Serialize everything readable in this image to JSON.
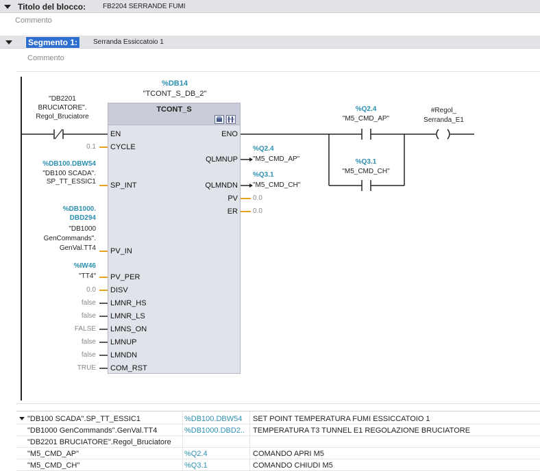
{
  "block": {
    "title_label": "Titolo del blocco:",
    "title_value": "FB2204 SERRANDE FUMI",
    "comment": "Commento"
  },
  "segment": {
    "label": "Segmento 1:",
    "title": "Serranda Essiccatoio 1",
    "comment": "Commento"
  },
  "instance": {
    "address": "%DB14",
    "name": "\"TCONT_S_DB_2\"",
    "type": "TCONT_S"
  },
  "contact": {
    "name_lines": [
      "\"DB2201",
      "BRUCIATORE\".",
      "Regol_Bruciatore"
    ]
  },
  "inputs": {
    "en": "EN",
    "cycle": {
      "pin": "CYCLE",
      "value": "0.1"
    },
    "sp_int": {
      "pin": "SP_INT",
      "address": "%DB100.DBW54",
      "name_lines": [
        "\"DB100 SCADA\".",
        "SP_TT_ESSIC1"
      ]
    },
    "pv_in": {
      "pin": "PV_IN",
      "address_lines": [
        "%DB1000.",
        "DBD294"
      ],
      "name_lines": [
        "\"DB1000",
        "GenCommands\".",
        "GenVal.TT4"
      ]
    },
    "pv_per": {
      "pin": "PV_PER",
      "address": "%IW46",
      "name": "\"TT4\""
    },
    "disv": {
      "pin": "DISV",
      "value": "0.0"
    },
    "lmnr_hs": {
      "pin": "LMNR_HS",
      "value": "false"
    },
    "lmnr_ls": {
      "pin": "LMNR_LS",
      "value": "false"
    },
    "lmns_on": {
      "pin": "LMNS_ON",
      "value": "FALSE"
    },
    "lmnup": {
      "pin": "LMNUP",
      "value": "false"
    },
    "lmndn": {
      "pin": "LMNDN",
      "value": "false"
    },
    "com_rst": {
      "pin": "COM_RST",
      "value": "TRUE"
    }
  },
  "outputs": {
    "eno": "ENO",
    "qlmnup": {
      "pin": "QLMNUP",
      "address": "%Q2.4",
      "name": "\"M5_CMD_AP\""
    },
    "qlmndn": {
      "pin": "QLMNDN",
      "address": "%Q3.1",
      "name": "\"M5_CMD_CH\""
    },
    "pv": {
      "pin": "PV",
      "value": "0.0"
    },
    "er": {
      "pin": "ER",
      "value": "0.0"
    }
  },
  "right_contacts": {
    "q24": {
      "address": "%Q2.4",
      "name": "\"M5_CMD_AP\""
    },
    "q31": {
      "address": "%Q3.1",
      "name": "\"M5_CMD_CH\""
    }
  },
  "coil": {
    "name_lines": [
      "#Regol_",
      "Serranda_E1"
    ]
  },
  "info_table": [
    {
      "symbol": "\"DB100 SCADA\".SP_TT_ESSIC1",
      "address": "%DB100.DBW54",
      "comment": "SET POINT TEMPERATURA FUMI ESSICCATOIO 1"
    },
    {
      "symbol": "\"DB1000 GenCommands\".GenVal.TT4",
      "address": "%DB1000.DBD2...",
      "comment": "TEMPERATURA T3 TUNNEL E1 REGOLAZIONE BRUCIATORE"
    },
    {
      "symbol": "\"DB2201 BRUCIATORE\".Regol_Bruciatore",
      "address": "",
      "comment": ""
    },
    {
      "symbol": "\"M5_CMD_AP\"",
      "address": "%Q2.4",
      "comment": "COMANDO APRI M5"
    },
    {
      "symbol": "\"M5_CMD_CH\"",
      "address": "%Q3.1",
      "comment": "COMANDO CHIUDI M5"
    }
  ],
  "colors": {
    "address": "#2b8fb0",
    "wire_orange": "#e7a21b",
    "selection": "#2f6fd0"
  }
}
